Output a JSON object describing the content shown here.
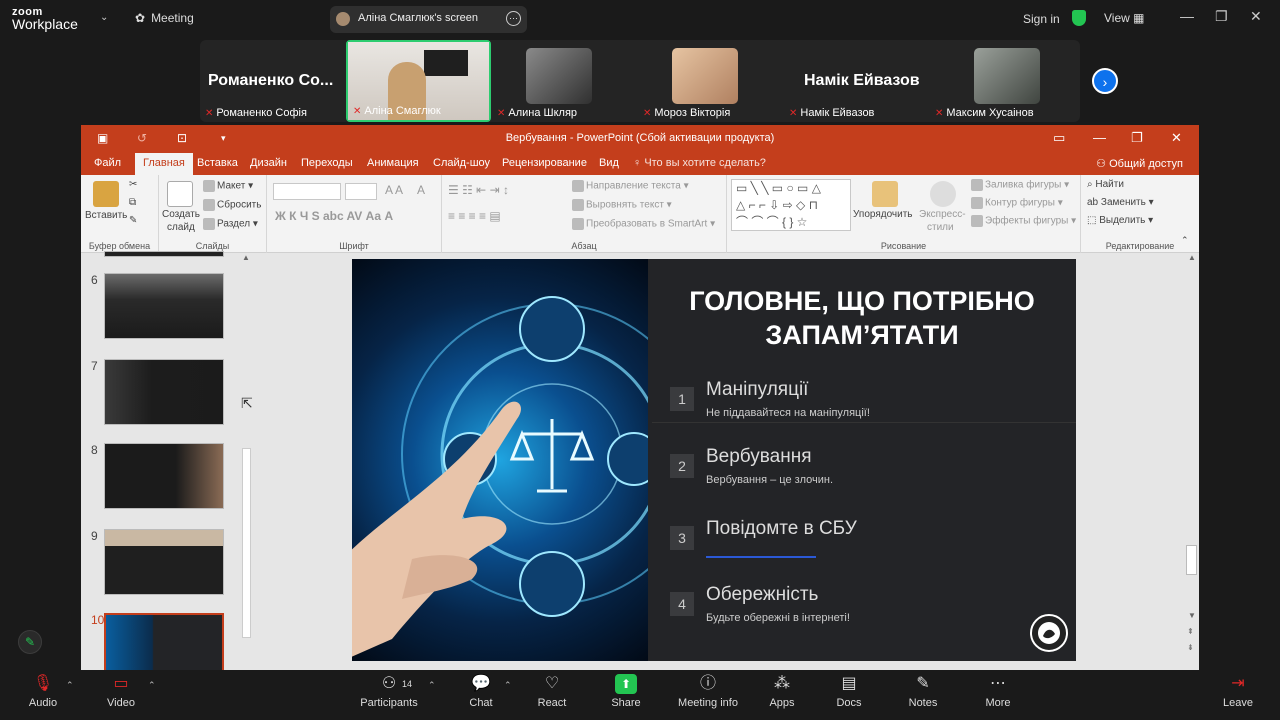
{
  "zoom": {
    "logo_top": "zoom",
    "logo_bottom": "Workplace",
    "meeting_label": "Meeting",
    "screen_label": "Аліна Смаглюк's screen",
    "sign_in": "Sign in",
    "view": "View",
    "participants_count": "14"
  },
  "gallery": [
    {
      "big": "Романенко Со...",
      "name": "Романенко Софія"
    },
    {
      "big": "",
      "name": "Аліна Смаглюк"
    },
    {
      "big": "",
      "name": "Алина Шкляр"
    },
    {
      "big": "",
      "name": "Мороз Вікторія"
    },
    {
      "big": "Намік Ейвазов",
      "name": "Намік Ейвазов"
    },
    {
      "big": "",
      "name": "Максим Хусаінов"
    }
  ],
  "ppt": {
    "window_title": "Вербування - PowerPoint (Сбой активации продукта)",
    "tabs": [
      "Файл",
      "Главная",
      "Вставка",
      "Дизайн",
      "Переходы",
      "Анимация",
      "Слайд-шоу",
      "Рецензирование",
      "Вид"
    ],
    "tell_me": "Что вы хотите сделать?",
    "share": "Общий доступ",
    "ribbon": {
      "paste": "Вставить",
      "clipboard": "Буфер обмена",
      "new_slide_1": "Создать",
      "new_slide_2": "слайд",
      "layout": "Макет",
      "reset": "Сбросить",
      "section": "Раздел",
      "slides": "Слайды",
      "font": "Шрифт",
      "paragraph": "Абзац",
      "text_direction": "Направление текста",
      "align_text": "Выровнять текст",
      "smartart": "Преобразовать в SmartArt",
      "arrange": "Упорядочить",
      "quick_styles_1": "Экспресс-",
      "quick_styles_2": "стили",
      "shape_fill": "Заливка фигуры",
      "shape_outline": "Контур фигуры",
      "shape_effects": "Эффекты фигуры",
      "drawing": "Рисование",
      "find": "Найти",
      "replace": "Заменить",
      "select": "Выделить",
      "editing": "Редактирование"
    },
    "thumbnails": [
      "6",
      "7",
      "8",
      "9",
      "10"
    ]
  },
  "slide": {
    "title": "ГОЛОВНЕ, ЩО ПОТРІБНО ЗАПАМ’ЯТАТИ",
    "items": [
      {
        "num": "1",
        "heading": "Маніпуляції",
        "sub": "Не піддавайтеся на маніпуляції!"
      },
      {
        "num": "2",
        "heading": "Вербування",
        "sub": "Вербування – це злочин."
      },
      {
        "num": "3",
        "heading": "Повідомте в СБУ",
        "sub": ""
      },
      {
        "num": "4",
        "heading": "Обережність",
        "sub": "Будьте обережні в інтернеті!"
      }
    ]
  },
  "toolbar": {
    "audio": "Audio",
    "video": "Video",
    "participants": "Participants",
    "chat": "Chat",
    "react": "React",
    "share": "Share",
    "meeting_info": "Meeting info",
    "apps": "Apps",
    "docs": "Docs",
    "notes": "Notes",
    "more": "More",
    "leave": "Leave"
  }
}
